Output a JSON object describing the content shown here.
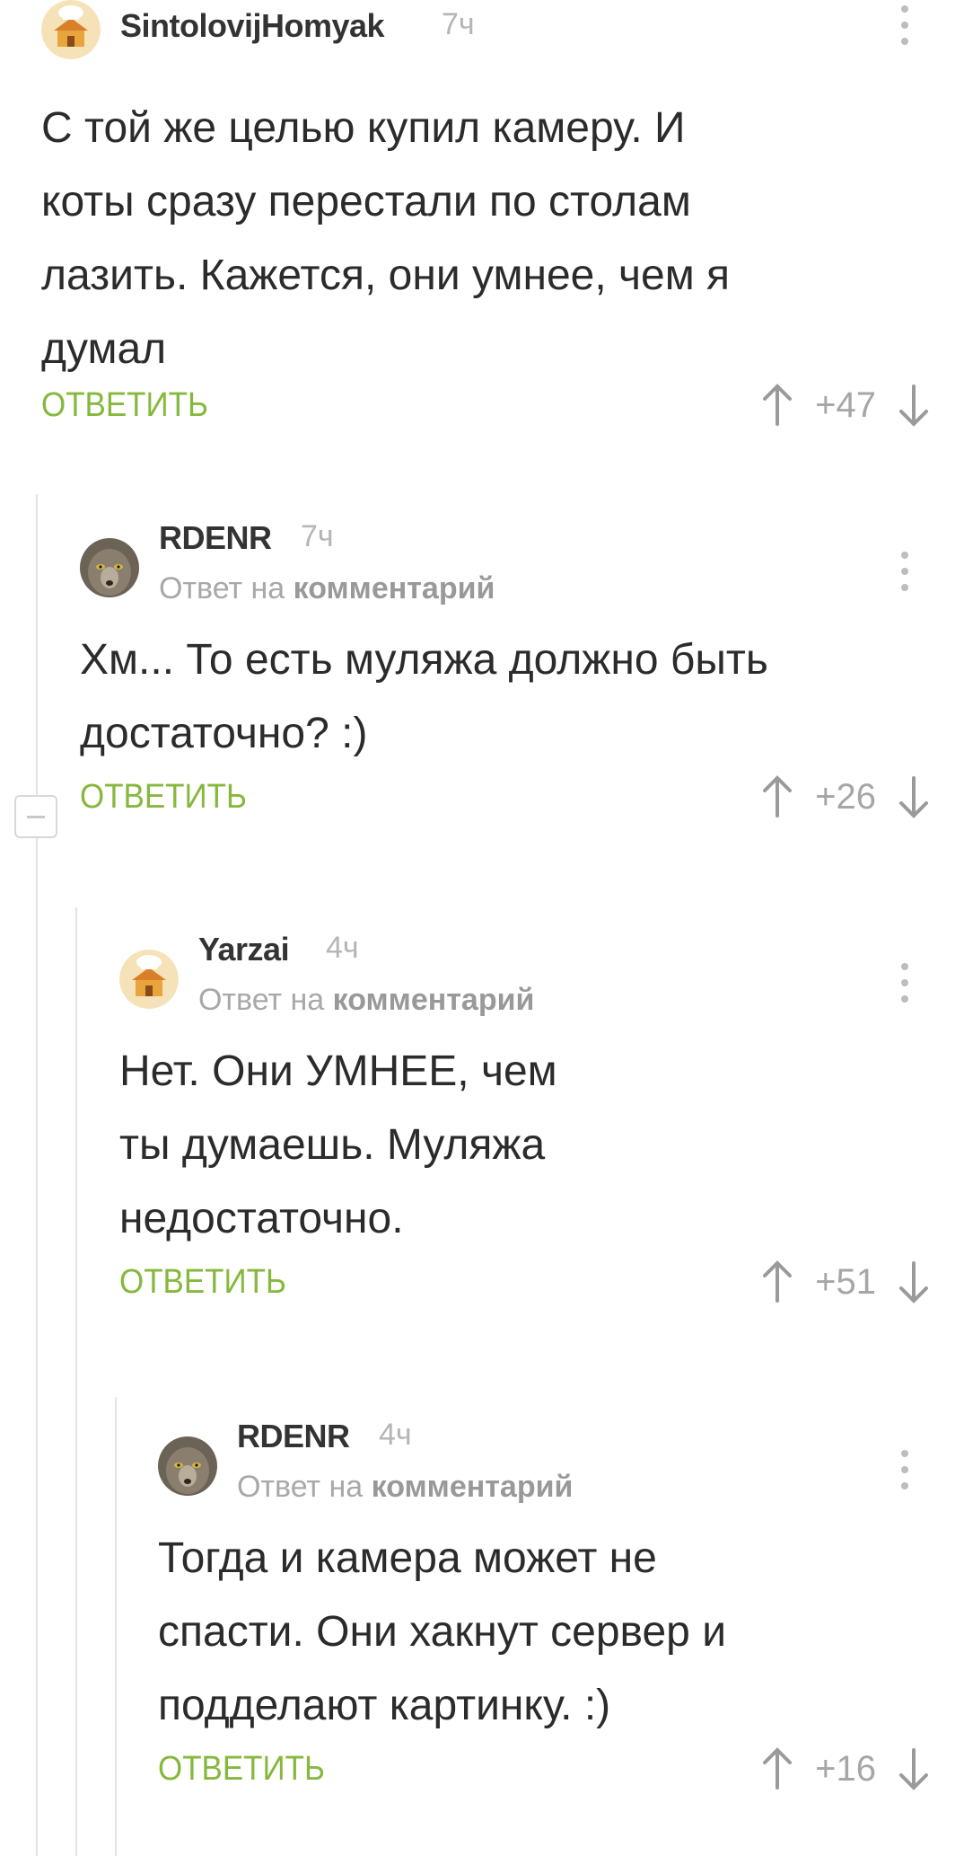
{
  "comments": [
    {
      "username": "SintolovijHomyak",
      "time": "7ч",
      "reply_to": "",
      "reply_to_target": "",
      "text": "С той же целью купил камеру. И\nкоты сразу перестали по столам\nлазить. Кажется, они умнее, чем я\nдумал",
      "reply_label": "ОТВЕТИТЬ",
      "rating": "+47",
      "avatar": "chef-hat-house-icon"
    },
    {
      "username": "RDENR",
      "time": "7ч",
      "reply_to": "Ответ на",
      "reply_to_target": "комментарий",
      "text": "Хм... То есть муляжа должно быть\nдостаточно? :)",
      "reply_label": "ОТВЕТИТЬ",
      "rating": "+26",
      "avatar": "wolf-photo"
    },
    {
      "username": "Yarzai",
      "time": "4ч",
      "reply_to": "Ответ на",
      "reply_to_target": "комментарий",
      "text": "Нет. Они УМНЕЕ, чем\nты думаешь. Муляжа\nнедостаточно.",
      "reply_label": "ОТВЕТИТЬ",
      "rating": "+51",
      "avatar": "chef-hat-house-icon"
    },
    {
      "username": "RDENR",
      "time": "4ч",
      "reply_to": "Ответ на",
      "reply_to_target": "комментарий",
      "text": "Тогда и камера может не\nспасти. Они хакнут сервер и\nподделают картинку. :)",
      "reply_label": "ОТВЕТИТЬ",
      "rating": "+16",
      "avatar": "wolf-photo"
    }
  ],
  "colors": {
    "reply_link": "#86b83e",
    "thread_line": "#e3e3e3",
    "muted_text": "#a8a8a8"
  }
}
